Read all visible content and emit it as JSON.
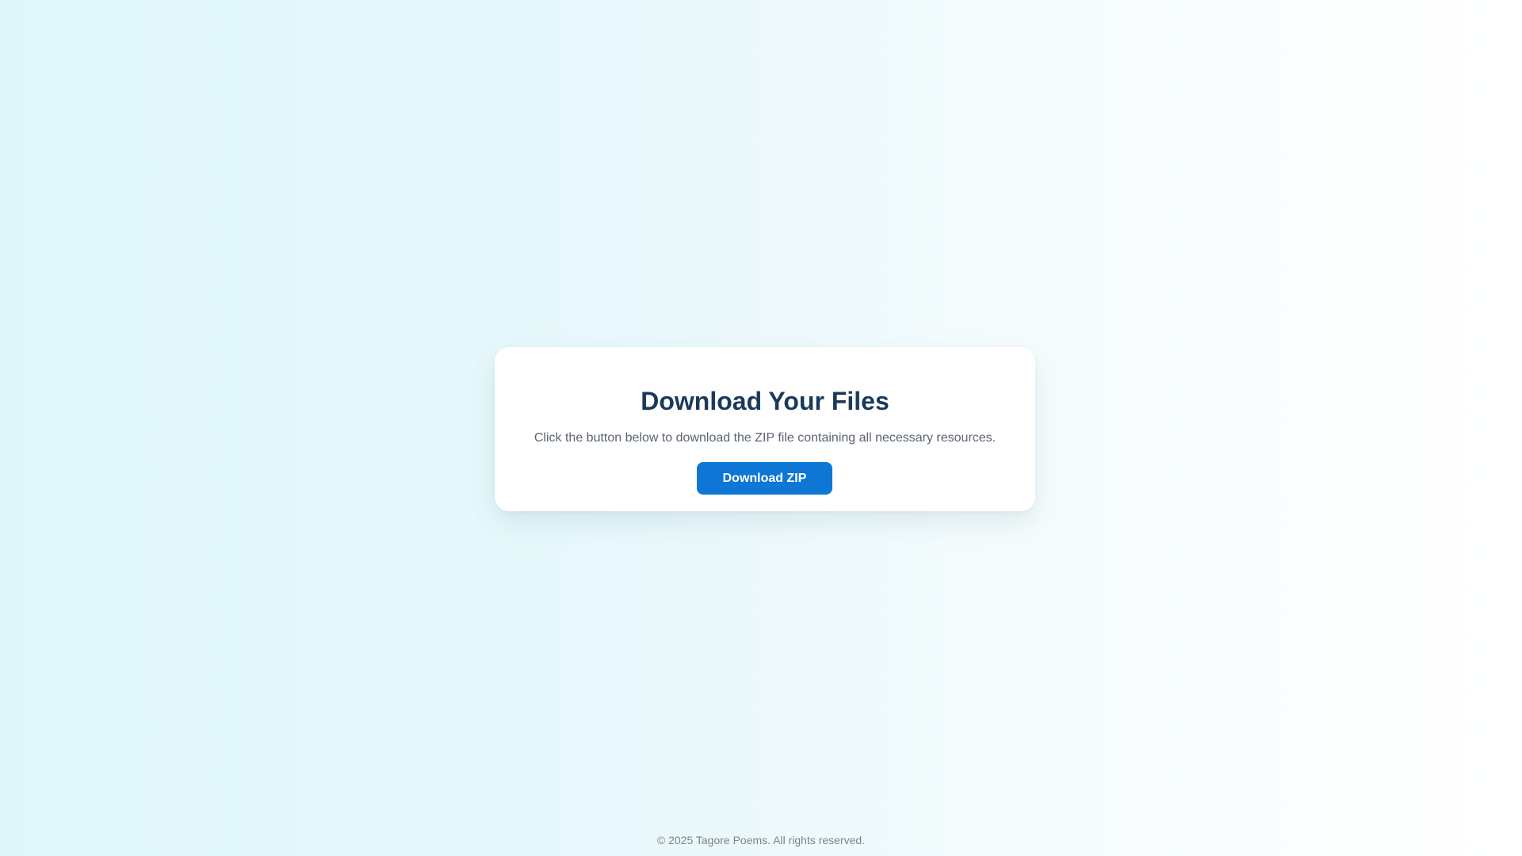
{
  "card": {
    "title": "Download Your Files",
    "description": "Click the button below to download the ZIP file containing all necessary resources.",
    "button_label": "Download ZIP"
  },
  "footer": {
    "copyright": "© 2025 Tagore Poems. All rights reserved."
  },
  "colors": {
    "title": "#1b3a5b",
    "button": "#0e76d4",
    "button_text": "#ffffff",
    "description": "#5a6472",
    "footer": "#7a8490",
    "background_left": "#dff6f9",
    "background_right": "#ffffff"
  }
}
